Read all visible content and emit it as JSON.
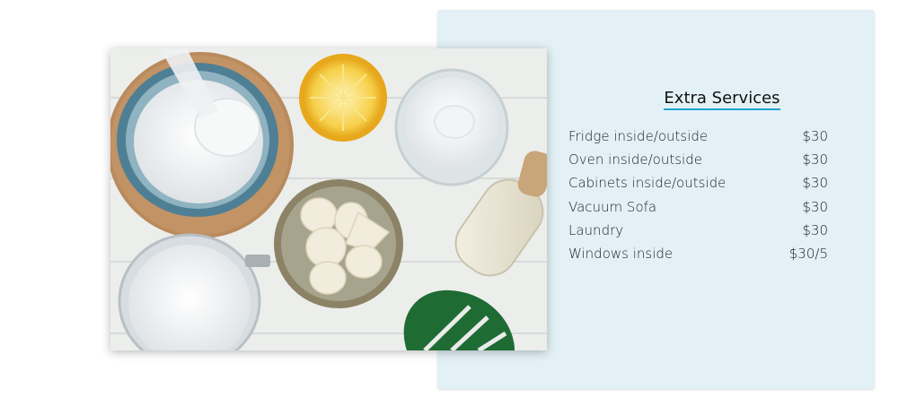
{
  "section": {
    "title": "Extra Services",
    "accent_color": "#21a3cf",
    "panel_color": "#e3f1f6"
  },
  "image": {
    "subject": "natural-cleaning-ingredients-photo",
    "icon": "photo-icon"
  },
  "services": [
    {
      "name": "Fridge inside/outside",
      "price": "$30"
    },
    {
      "name": "Oven inside/outside",
      "price": "$30"
    },
    {
      "name": "Cabinets inside/outside",
      "price": "$30"
    },
    {
      "name": "Vacuum Sofa",
      "price": "$30"
    },
    {
      "name": "Laundry",
      "price": "$30"
    },
    {
      "name": "Windows inside",
      "price": "$30/5"
    }
  ]
}
